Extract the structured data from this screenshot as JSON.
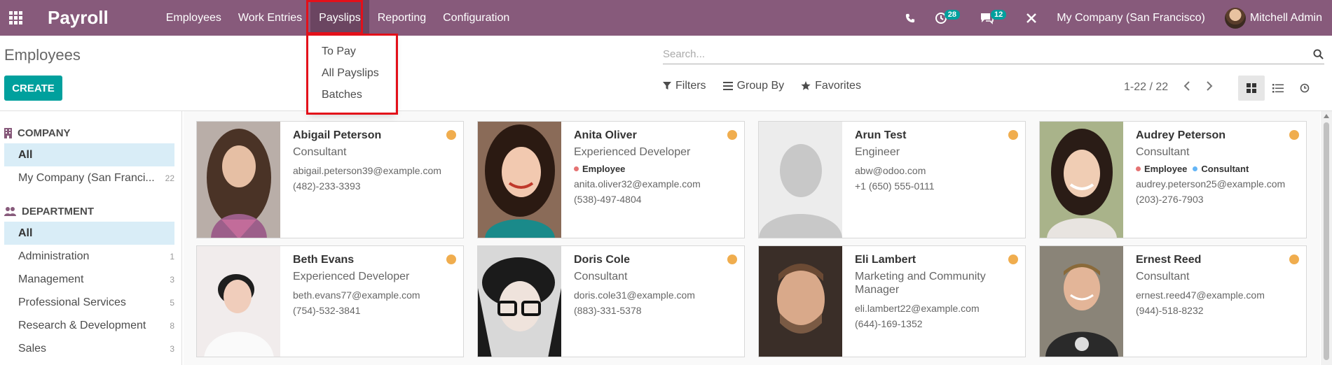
{
  "navbar": {
    "app_name": "Payroll",
    "menus": [
      {
        "label": "Employees"
      },
      {
        "label": "Work Entries"
      },
      {
        "label": "Payslips"
      },
      {
        "label": "Reporting"
      },
      {
        "label": "Configuration"
      }
    ],
    "activity_count": "28",
    "message_count": "12",
    "company": "My Company (San Francisco)",
    "user": "Mitchell Admin"
  },
  "dropdown": {
    "items": [
      {
        "label": "To Pay"
      },
      {
        "label": "All Payslips"
      },
      {
        "label": "Batches"
      }
    ]
  },
  "control_panel": {
    "title": "Employees",
    "create_label": "CREATE",
    "search_placeholder": "Search...",
    "filters_label": "Filters",
    "groupby_label": "Group By",
    "favorites_label": "Favorites",
    "pager": "1-22 / 22"
  },
  "sidebar": {
    "company_header": "COMPANY",
    "company_items": [
      {
        "label": "All",
        "count": ""
      },
      {
        "label": "My Company (San Franci...",
        "count": "22"
      }
    ],
    "department_header": "DEPARTMENT",
    "department_items": [
      {
        "label": "All",
        "count": ""
      },
      {
        "label": "Administration",
        "count": "1"
      },
      {
        "label": "Management",
        "count": "3"
      },
      {
        "label": "Professional Services",
        "count": "5"
      },
      {
        "label": "Research & Development",
        "count": "8"
      },
      {
        "label": "Sales",
        "count": "3"
      }
    ]
  },
  "employees": [
    {
      "name": "Abigail Peterson",
      "job": "Consultant",
      "email": "abigail.peterson39@example.com",
      "phone": "(482)-233-3393"
    },
    {
      "name": "Anita Oliver",
      "job": "Experienced Developer",
      "tag1": "Employee",
      "email": "anita.oliver32@example.com",
      "phone": "(538)-497-4804"
    },
    {
      "name": "Arun Test",
      "job": "Engineer",
      "email": "abw@odoo.com",
      "phone": "+1 (650) 555-0111"
    },
    {
      "name": "Audrey Peterson",
      "job": "Consultant",
      "tag1": "Employee",
      "tag2": "Consultant",
      "email": "audrey.peterson25@example.com",
      "phone": "(203)-276-7903"
    },
    {
      "name": "Beth Evans",
      "job": "Experienced Developer",
      "email": "beth.evans77@example.com",
      "phone": "(754)-532-3841"
    },
    {
      "name": "Doris Cole",
      "job": "Consultant",
      "email": "doris.cole31@example.com",
      "phone": "(883)-331-5378"
    },
    {
      "name": "Eli Lambert",
      "job": "Marketing and Community Manager",
      "email": "eli.lambert22@example.com",
      "phone": "(644)-169-1352"
    },
    {
      "name": "Ernest Reed",
      "job": "Consultant",
      "email": "ernest.reed47@example.com",
      "phone": "(944)-518-8232"
    }
  ],
  "colors": {
    "brand": "#875a7b",
    "accent": "#00a09d",
    "highlight": "#e3101a",
    "status": "#f0ad4e",
    "tag_employee": "#e57373",
    "tag_consultant": "#64b5f6"
  }
}
